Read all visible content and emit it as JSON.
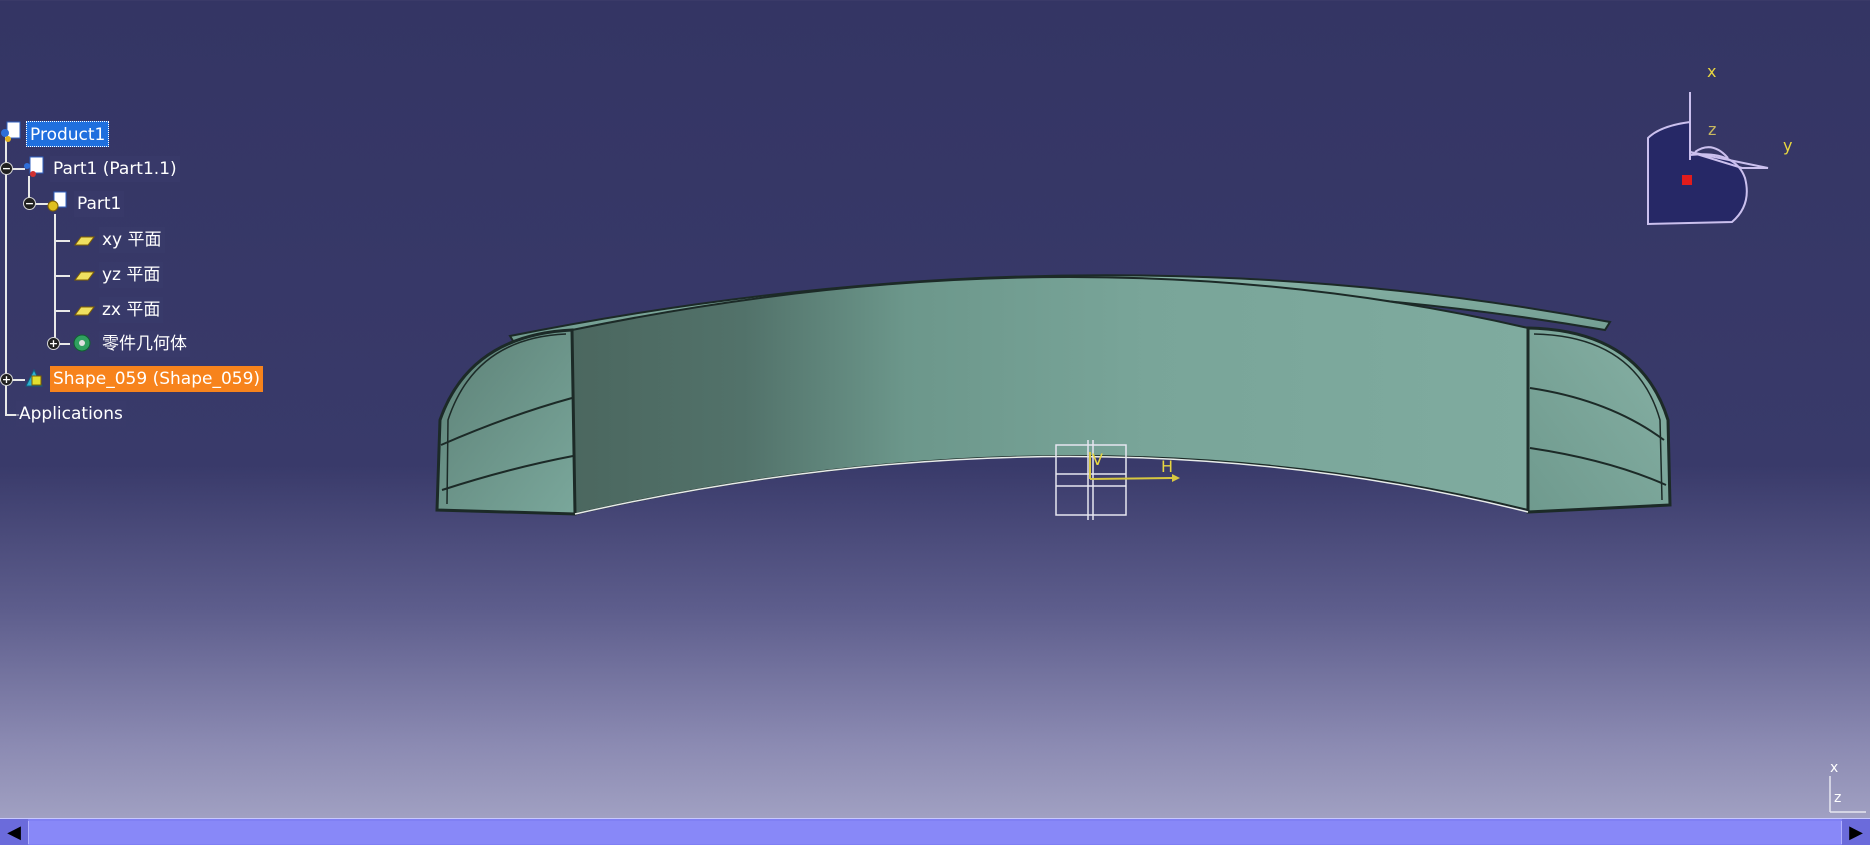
{
  "tree": {
    "product": "Product1",
    "part_instance": "Part1 (Part1.1)",
    "part": "Part1",
    "xy_plane": "xy 平面",
    "yz_plane": "yz 平面",
    "zx_plane": "zx 平面",
    "part_body": "零件几何体",
    "shape": "Shape_059 (Shape_059)",
    "applications": "Applications"
  },
  "compass": {
    "x": "x",
    "y": "y",
    "z": "z"
  },
  "sketch_axes": {
    "h": "H",
    "v": "V"
  },
  "mini_axes": {
    "x": "x",
    "z": "z"
  },
  "scrollbar": {
    "left_arrow": "◀",
    "right_arrow": "▶"
  },
  "colors": {
    "background_top": "#343564",
    "background_bottom": "#a8a8c8",
    "model_surface": "#7fa99d",
    "model_shadow": "#4a6660",
    "selection": "#1f6fde",
    "highlight": "#f7831c",
    "compass_axis": "#e8d640"
  }
}
